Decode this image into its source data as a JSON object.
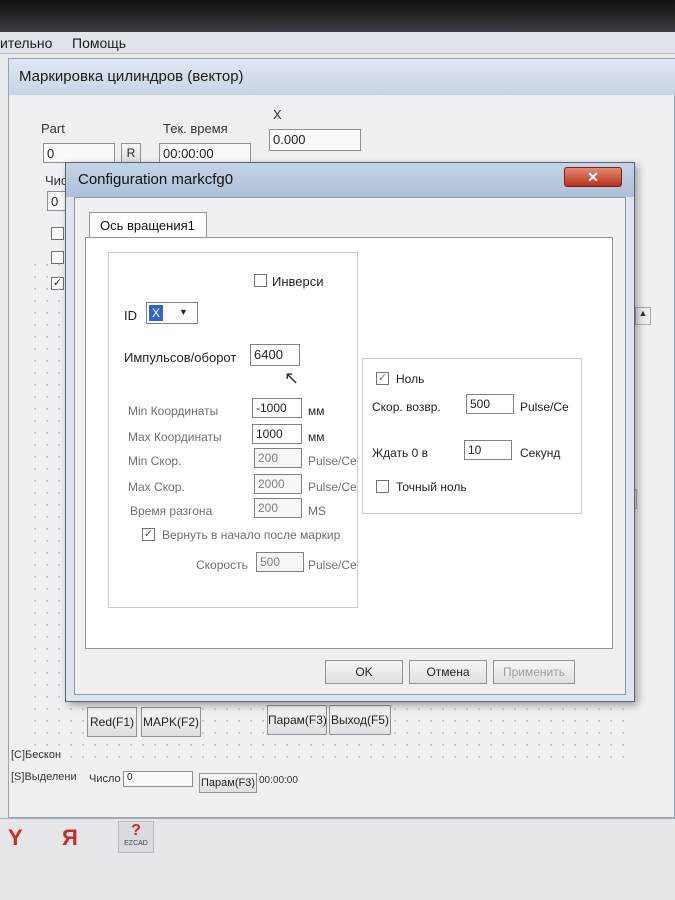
{
  "menu": {
    "left_item": "ительно",
    "help": "Помощь"
  },
  "app": {
    "title": "Маркировка цилиндров (вектор)",
    "part_label": "Part",
    "part_value": "0",
    "part_btn": "R",
    "time_label": "Тек. время",
    "time_value": "00:00:00",
    "x_label": "X",
    "x_value": "0.000",
    "count_label_partial": "Чис",
    "count_value": "0",
    "checkbox_checked_mark": "✓",
    "buttons": {
      "red": "Red(F1)",
      "mark": "MAPK(F2)",
      "params": "Парам(F3)",
      "exit": "Выход(F5)"
    },
    "status_infinite": "[C]Бескон",
    "status_select": "[S]Выделени",
    "status_count": "Число",
    "status_count_value": "0",
    "status_params": "Парам(F3)",
    "status_time": "00:00:00"
  },
  "dialog": {
    "title": "Configuration markcfg0",
    "close": "✕",
    "tab": "Ось вращения1",
    "inverse_label": "Инверси",
    "inverse_checked": false,
    "id_label": "ID",
    "id_value": "X",
    "pulses_label": "Импульсов/оборот",
    "pulses_value": "6400",
    "min_coord_label": "Min Координаты",
    "min_coord_value": "-1000",
    "min_coord_unit": "мм",
    "max_coord_label": "Max Координаты",
    "max_coord_value": "1000",
    "max_coord_unit": "мм",
    "min_speed_label": "Min Скор.",
    "min_speed_value": "200",
    "min_speed_unit": "Pulse/Ce",
    "max_speed_label": "Max Скор.",
    "max_speed_value": "2000",
    "max_speed_unit": "Pulse/Ce",
    "accel_label": "Время разгона",
    "accel_value": "200",
    "accel_unit": "MS",
    "return_label": "Вернуть в начало после маркир",
    "return_checked": true,
    "speed_label": "Скорость",
    "speed_value": "500",
    "speed_unit": "Pulse/Ce",
    "zero_label": "Ноль",
    "zero_checked": true,
    "return_speed_label": "Скор. возвр.",
    "return_speed_value": "500",
    "return_speed_unit": "Pulse/Ce",
    "wait_label": "Ждать 0 в",
    "wait_value": "10",
    "wait_unit": "Секунд",
    "exact_zero_label": "Точный ноль",
    "exact_zero_checked": false,
    "ok": "OK",
    "cancel": "Отмена",
    "apply": "Применить"
  },
  "taskbar": {
    "icon1": "Y",
    "icon2": "Я",
    "icon3": "EZCAD"
  },
  "colors": {
    "accent_close": "#c0392b",
    "dialog_title": "#b8c8de"
  }
}
